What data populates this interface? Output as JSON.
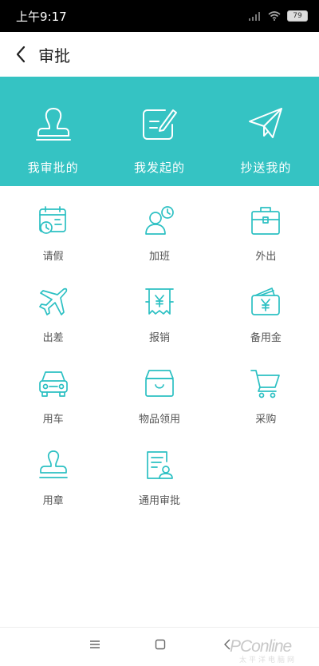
{
  "status_bar": {
    "time": "上午9:17",
    "battery": "79"
  },
  "header": {
    "title": "审批"
  },
  "tabs": [
    {
      "label": "我审批的",
      "icon": "stamp-icon"
    },
    {
      "label": "我发起的",
      "icon": "edit-form-icon"
    },
    {
      "label": "抄送我的",
      "icon": "paper-plane-icon"
    }
  ],
  "grid": [
    {
      "label": "请假",
      "icon": "calendar-clock-icon"
    },
    {
      "label": "加班",
      "icon": "person-clock-icon"
    },
    {
      "label": "外出",
      "icon": "briefcase-icon"
    },
    {
      "label": "出差",
      "icon": "airplane-icon"
    },
    {
      "label": "报销",
      "icon": "receipt-yuan-icon"
    },
    {
      "label": "备用金",
      "icon": "wallet-yuan-icon"
    },
    {
      "label": "用车",
      "icon": "car-icon"
    },
    {
      "label": "物品领用",
      "icon": "box-icon"
    },
    {
      "label": "采购",
      "icon": "shopping-cart-icon"
    },
    {
      "label": "用章",
      "icon": "seal-icon"
    },
    {
      "label": "通用审批",
      "icon": "document-person-icon"
    }
  ],
  "watermark": {
    "brand": "PConline",
    "sub": "太平洋电脑网"
  },
  "colors": {
    "accent": "#35c3c3",
    "icon": "#2cc0c3",
    "header_text": "#ffffff"
  }
}
